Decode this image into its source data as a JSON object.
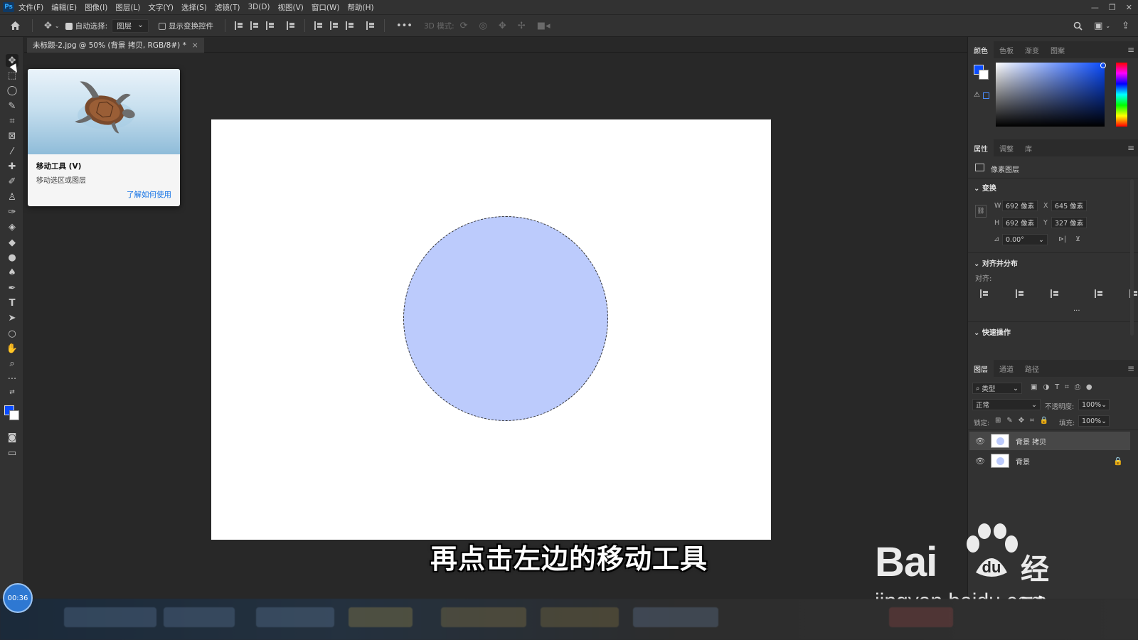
{
  "app": {
    "logo": "Ps"
  },
  "menu": [
    "文件(F)",
    "编辑(E)",
    "图像(I)",
    "图层(L)",
    "文字(Y)",
    "选择(S)",
    "滤镜(T)",
    "3D(D)",
    "视图(V)",
    "窗口(W)",
    "帮助(H)"
  ],
  "window_controls": [
    "—",
    "❐",
    "✕"
  ],
  "options_bar": {
    "auto_select_label": "自动选择:",
    "auto_select_value": "图层",
    "show_transform_label": "显示变换控件",
    "mode_3d_label": "3D 模式:"
  },
  "doc_tab": {
    "title": "未标题-2.jpg @ 50% (背景 拷贝, RGB/8#) *",
    "close": "×"
  },
  "tooltip": {
    "title": "移动工具 (V)",
    "description": "移动选区或图层",
    "link": "了解如何使用"
  },
  "color_panel": {
    "tabs": [
      "颜色",
      "色板",
      "渐变",
      "图案"
    ]
  },
  "properties_panel": {
    "tabs": [
      "属性",
      "调整",
      "库"
    ],
    "layer_type": "像素图层",
    "transform_title": "变换",
    "w_label": "W",
    "w_value": "692 像素",
    "h_label": "H",
    "h_value": "692 像素",
    "x_label": "X",
    "x_value": "645 像素",
    "y_label": "Y",
    "y_value": "327 像素",
    "angle_value": "0.00°",
    "align_title": "对齐并分布",
    "align_label": "对齐:",
    "more": "···",
    "quick_actions_title": "快速操作"
  },
  "layers_panel": {
    "tabs": [
      "图层",
      "通道",
      "路径"
    ],
    "filter_label": "类型",
    "blend_mode": "正常",
    "opacity_label": "不透明度:",
    "opacity_value": "100%",
    "lock_label": "锁定:",
    "fill_label": "填充:",
    "fill_value": "100%",
    "layers": [
      {
        "name": "背景 拷贝",
        "selected": true,
        "locked": false
      },
      {
        "name": "背景",
        "selected": false,
        "locked": true
      }
    ]
  },
  "colors": {
    "foreground": "#0a4cff",
    "background": "#ffffff",
    "circle_fill": "#bccbfc",
    "accent_link": "#1473e6"
  },
  "subtitle": "再点击左边的移动工具",
  "watermark": {
    "bai": "Bai",
    "du": "du",
    "jingyan": "经验",
    "url": "jingyan.baidu.com"
  },
  "timer": "00:36"
}
